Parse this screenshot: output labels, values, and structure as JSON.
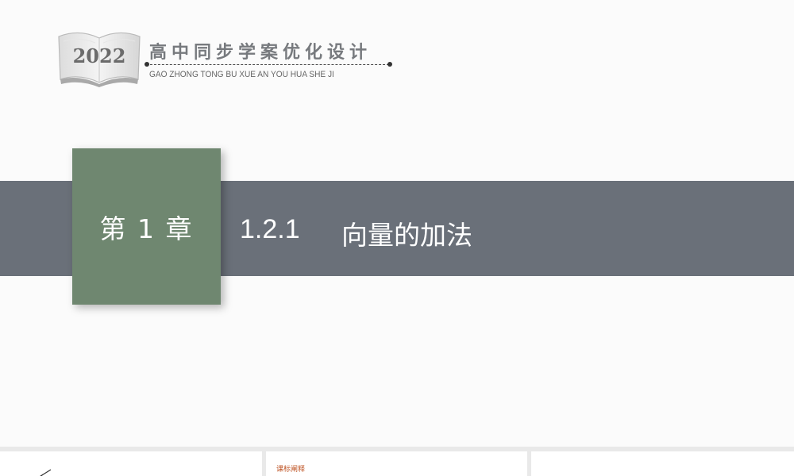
{
  "brand": {
    "year": "2022",
    "title": "高中同步学案优化设计",
    "subtitle": "GAO ZHONG TONG BU XUE AN YOU HUA SHE JI"
  },
  "slide": {
    "chapter": "第 1 章",
    "section_number": "1.2.1",
    "section_title": "向量的加法"
  },
  "thumbnails": [
    {
      "label": ""
    },
    {
      "label": "课标阐释"
    },
    {
      "label": ""
    }
  ],
  "colors": {
    "band": "#6a7079",
    "chapter_box": "#6f8770",
    "thumb_label": "#c0582a"
  }
}
